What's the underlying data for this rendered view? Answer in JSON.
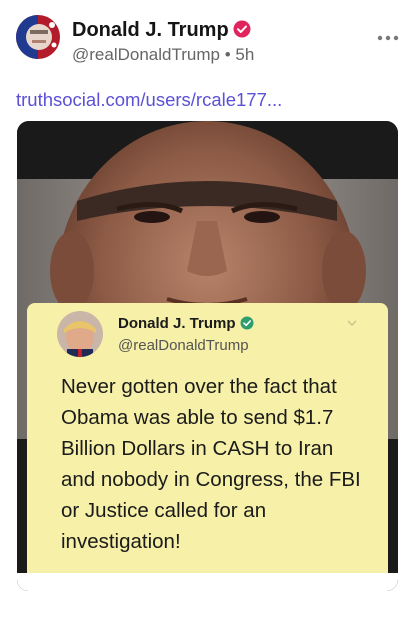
{
  "post": {
    "author_name": "Donald J. Trump",
    "handle": "@realDonaldTrump",
    "separator": "•",
    "timestamp": "5h",
    "more_icon": "more-horizontal-icon",
    "link_text": "truthsocial.com/users/rcale177..."
  },
  "embedded_tweet": {
    "author_name": "Donald J. Trump",
    "handle": "@realDonaldTrump",
    "text": "Never gotten over the fact that Obama was able to send $1.7 Billion Dollars in CASH to Iran and nobody in Congress, the FBI or Justice called for an investigation!"
  },
  "colors": {
    "link": "#5b50d6",
    "verified_badge": "#e0245e",
    "tweet_card": "#f6f0a8",
    "tweet_verified": "#2f9e6f"
  }
}
